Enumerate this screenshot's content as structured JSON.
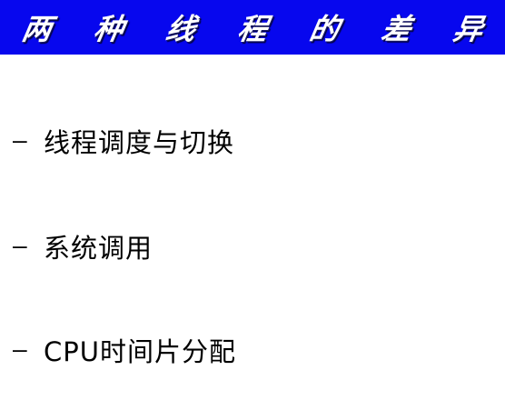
{
  "slide": {
    "title": "两 种 线 程 的 差 异",
    "colors": {
      "title_bar": "#0707ee",
      "title_text": "#ffffff",
      "background": "#ffffff",
      "body_text": "#000000"
    }
  },
  "bullets": [
    {
      "marker": "–",
      "text": "线程调度与切换"
    },
    {
      "marker": "–",
      "text": "系统调用"
    },
    {
      "marker": "–",
      "text": "CPU时间片分配"
    }
  ]
}
